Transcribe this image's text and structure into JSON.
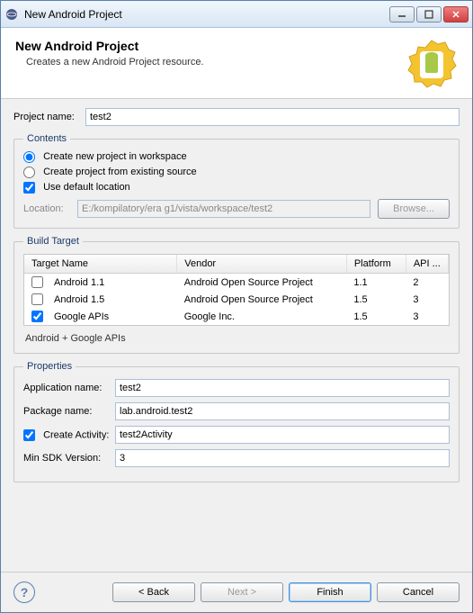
{
  "window": {
    "title": "New Android Project"
  },
  "header": {
    "title": "New Android Project",
    "subtitle": "Creates a new Android Project resource."
  },
  "project_name": {
    "label": "Project name:",
    "value": "test2"
  },
  "contents": {
    "legend": "Contents",
    "opt_new": "Create new project in workspace",
    "opt_existing": "Create project from existing source",
    "use_default": "Use default location",
    "location_label": "Location:",
    "location_value": "E:/kompilatory/era g1/vista/workspace/test2",
    "browse_label": "Browse..."
  },
  "build_target": {
    "legend": "Build Target",
    "columns": [
      "Target Name",
      "Vendor",
      "Platform",
      "API ..."
    ],
    "rows": [
      {
        "checked": false,
        "name": "Android 1.1",
        "vendor": "Android Open Source Project",
        "platform": "1.1",
        "api": "2"
      },
      {
        "checked": false,
        "name": "Android 1.5",
        "vendor": "Android Open Source Project",
        "platform": "1.5",
        "api": "3"
      },
      {
        "checked": true,
        "name": "Google APIs",
        "vendor": "Google Inc.",
        "platform": "1.5",
        "api": "3"
      }
    ],
    "caption": "Android + Google APIs"
  },
  "properties": {
    "legend": "Properties",
    "app_name_label": "Application name:",
    "app_name_value": "test2",
    "package_label": "Package name:",
    "package_value": "lab.android.test2",
    "create_activity_label": "Create Activity:",
    "create_activity_value": "test2Activity",
    "min_sdk_label": "Min SDK Version:",
    "min_sdk_value": "3"
  },
  "footer": {
    "back": "< Back",
    "next": "Next >",
    "finish": "Finish",
    "cancel": "Cancel"
  }
}
